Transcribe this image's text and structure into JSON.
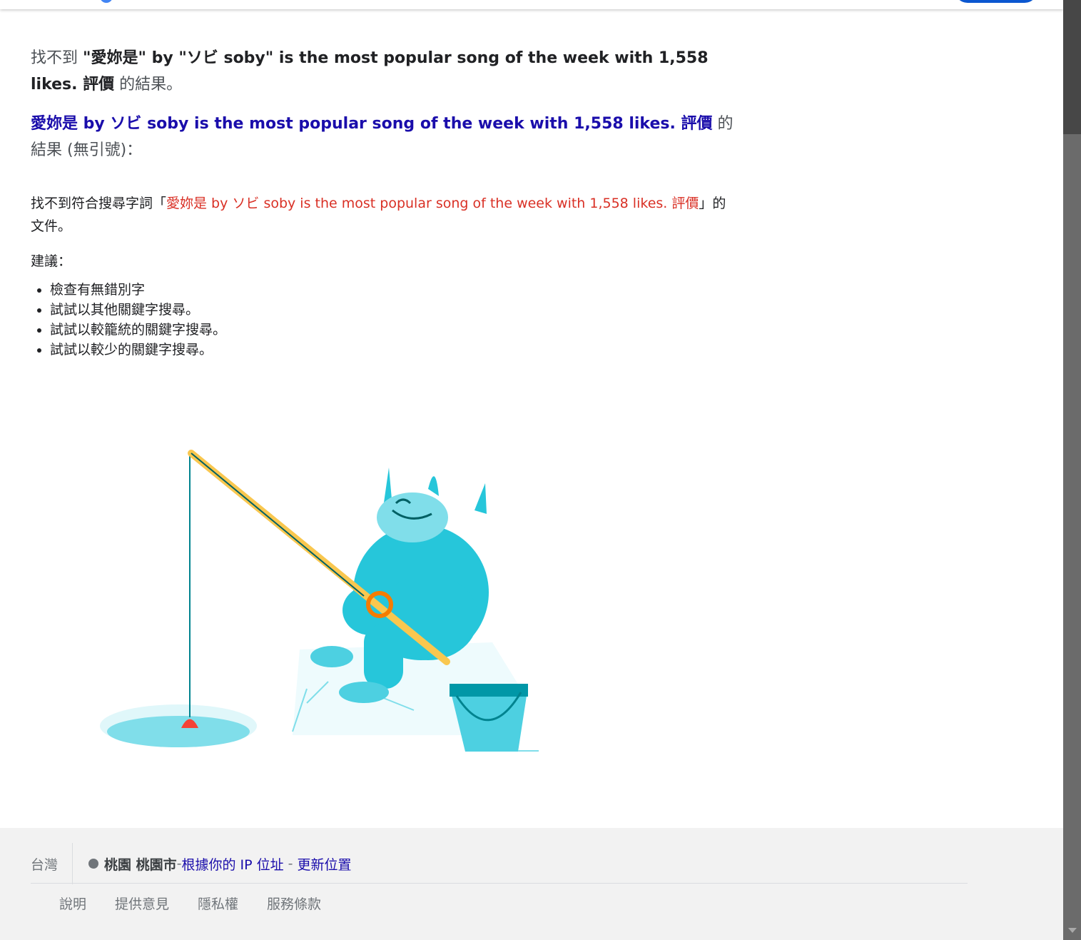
{
  "header": {},
  "result_message": {
    "prefix": "找不到",
    "query": "\"愛妳是\" by \"ソビ soby\" is the most popular song of the week with 1,558 likes. 評價",
    "suffix": " 的結果。"
  },
  "suggestion": {
    "link_text": "愛妳是 by ソビ soby is the most popular song of the week with 1,558 likes. 評價",
    "suffix": "的結果 (無引號)："
  },
  "no_results": {
    "prefix": "找不到符合搜尋字詞「",
    "query": "愛妳是 by ソビ soby is the most popular song of the week with 1,558 likes. 評價",
    "suffix": "」的文件。"
  },
  "tips": {
    "label": "建議：",
    "items": [
      "檢查有無錯別字",
      "試試以其他關鍵字搜尋。",
      "試試以較籠統的關鍵字搜尋。",
      "試試以較少的關鍵字搜尋。"
    ]
  },
  "footer": {
    "country": "台灣",
    "location": "桃園 桃園市",
    "location_dash": " - ",
    "location_source": "根據你的 IP 位址",
    "update_sep": " - ",
    "update_location": "更新位置",
    "links": [
      "說明",
      "提供意見",
      "隱私權",
      "服務條款"
    ]
  },
  "colors": {
    "link": "#1a0dab",
    "query_red": "#d93025",
    "footer_bg": "#f2f2f2",
    "yeti": "#26c6da"
  }
}
